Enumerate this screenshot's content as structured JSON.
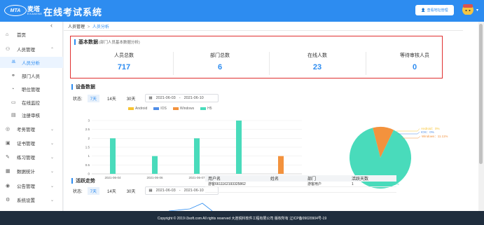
{
  "header": {
    "logo_text": "MTA",
    "logo_cn": "麦塔",
    "logo_en": "EXAMINE",
    "app_title": "在线考试系统",
    "address_button": "查看地址管理"
  },
  "sidebar": {
    "items": [
      {
        "label": "首页",
        "icon": "home-icon"
      },
      {
        "label": "人员管理",
        "icon": "user-icon"
      },
      {
        "label": "人员分析",
        "icon": "analysis-icon"
      },
      {
        "label": "部门人员",
        "icon": "group-icon"
      },
      {
        "label": "职位管理",
        "icon": "position-icon"
      },
      {
        "label": "在线监控",
        "icon": "monitor-icon"
      },
      {
        "label": "注册审核",
        "icon": "audit-icon"
      },
      {
        "label": "考务管理",
        "icon": "exam-icon"
      },
      {
        "label": "证书管理",
        "icon": "certificate-icon"
      },
      {
        "label": "练习管理",
        "icon": "practice-icon"
      },
      {
        "label": "数据统计",
        "icon": "stats-icon"
      },
      {
        "label": "公告管理",
        "icon": "notice-icon"
      },
      {
        "label": "系统设置",
        "icon": "settings-icon"
      }
    ]
  },
  "breadcrumb": {
    "root": "人员管理",
    "sep": ">",
    "current": "人员分析"
  },
  "basic": {
    "title": "基本数据",
    "subtitle": "(部门人员基本数据分析)",
    "stats": [
      {
        "label": "人员总数",
        "value": "717"
      },
      {
        "label": "部门总数",
        "value": "6"
      },
      {
        "label": "在线人数",
        "value": "23"
      },
      {
        "label": "等待审核人员",
        "value": "0"
      }
    ]
  },
  "device": {
    "title": "设备数据",
    "filter_label": "状态:",
    "ranges": [
      "7天",
      "14天",
      "30天"
    ],
    "date_from": "2021-06-03",
    "date_sep": "-",
    "date_to": "2021-06-10"
  },
  "active": {
    "title": "活跃走势",
    "filter_label": "状态:",
    "ranges": [
      "7天",
      "14天",
      "30天"
    ],
    "date_from": "2021-06-03",
    "date_sep": "-",
    "date_to": "2021-06-10"
  },
  "table": {
    "headers": [
      "用户名",
      "姓名",
      "部门",
      "活跃天数"
    ],
    "rows": [
      [
        "游客6611162193325862",
        "",
        "游客用户",
        "1"
      ],
      [
        "",
        "",
        "",
        ""
      ]
    ]
  },
  "colors": {
    "android": "#f7c331",
    "ios": "#4f8de8",
    "windows": "#f3923d",
    "h5": "#49dbbb",
    "accent": "#2d8cf0"
  },
  "chart_data": [
    {
      "type": "bar",
      "categories": [
        "2021-06-04",
        "2021-06-06",
        "2021-06-07",
        "2021-06-09",
        "2021-06-10"
      ],
      "series": [
        {
          "name": "Android",
          "values": [
            0,
            0,
            0,
            0,
            0
          ]
        },
        {
          "name": "IOS",
          "values": [
            0,
            0,
            0,
            0,
            0
          ]
        },
        {
          "name": "Windows",
          "values": [
            0,
            0,
            0,
            0,
            1
          ]
        },
        {
          "name": "H5",
          "values": [
            2,
            1,
            2,
            3,
            0
          ]
        }
      ],
      "yticks": [
        "0",
        "0.5",
        "1",
        "1.5",
        "2",
        "2.5",
        "3"
      ],
      "ylim": [
        0,
        3
      ],
      "legend": "top",
      "grid": true
    },
    {
      "type": "pie",
      "slices": [
        {
          "name": "Android",
          "percent": 0.0
        },
        {
          "name": "IOS",
          "percent": 0.0
        },
        {
          "name": "Windows",
          "percent": 11.11
        },
        {
          "name": "H5",
          "percent": 88.89
        }
      ],
      "labels": [
        "Android：0%",
        "IOS：0%",
        "Windows：11.11%",
        "H5：88.89%"
      ]
    }
  ],
  "footer": {
    "text": "Copyright © 2019 i3soft.com All rights reserved 大连锐科软件工程有限公司 版权所有 辽ICP备09020904号-19"
  }
}
